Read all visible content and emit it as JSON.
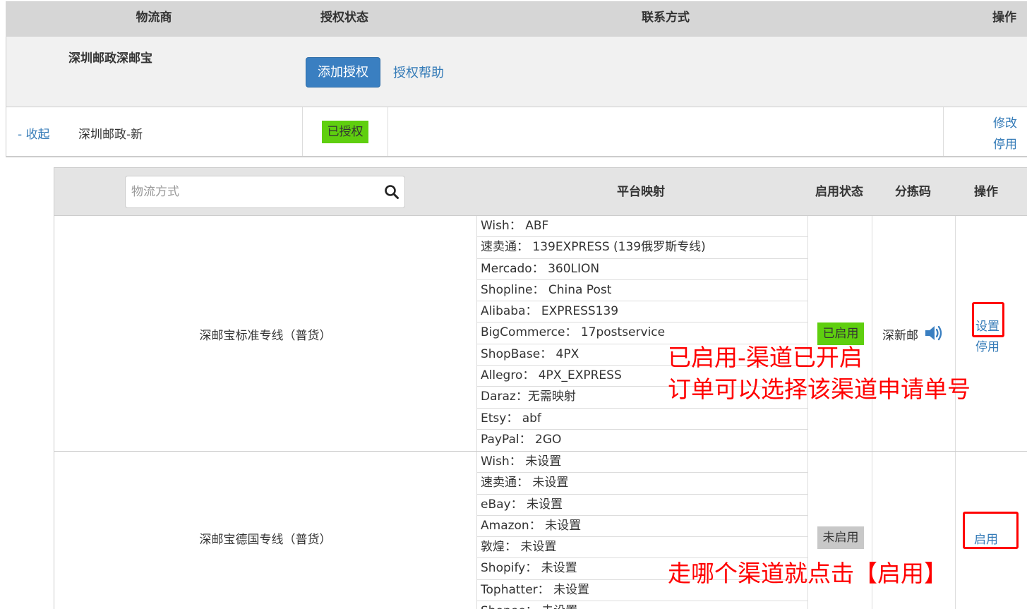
{
  "top_table": {
    "headers": [
      "物流商",
      "授权状态",
      "联系方式",
      "操作"
    ],
    "carrier_name": "深圳邮政深邮宝",
    "add_auth_label": "添加授权",
    "auth_help_label": "授权帮助",
    "account": {
      "collapse_label": "- 收起",
      "name": "深圳邮政-新",
      "status": "已授权",
      "edit_label": "修改",
      "disable_label": "停用"
    }
  },
  "channel_table": {
    "search_placeholder": "物流方式",
    "headers": [
      "平台映射",
      "启用状态",
      "分拣码",
      "操作"
    ],
    "channels": [
      {
        "name": "深邮宝标准专线（普货）",
        "mappings": [
          "Wish： ABF",
          "速卖通： 139EXPRESS (139俄罗斯专线)",
          "Mercado： 360LION",
          "Shopline： China Post",
          "Alibaba： EXPRESS139",
          "BigCommerce： 17postservice",
          "ShopBase： 4PX",
          "Allegro： 4PX_EXPRESS",
          "Daraz：无需映射",
          "Etsy： abf",
          "PayPal： 2GO"
        ],
        "status": "已启用",
        "sort_code": "深新邮",
        "actions": [
          "设置",
          "停用"
        ]
      },
      {
        "name": "深邮宝德国专线（普货）",
        "mappings": [
          "Wish： 未设置",
          "速卖通： 未设置",
          "eBay： 未设置",
          "Amazon： 未设置",
          "敦煌： 未设置",
          "Shopify： 未设置",
          "Tophatter： 未设置",
          "Shopee： 未设置"
        ],
        "status": "未启用",
        "actions": [
          "启用"
        ]
      }
    ]
  },
  "annotations": {
    "enabled_note_line1": "已启用-渠道已开启",
    "enabled_note_line2": "订单可以选择该渠道申请单号",
    "enable_hint": "走哪个渠道就点击【启用】"
  },
  "colors": {
    "header_bg": "#d6d6d6",
    "primary_button": "#3a7fc1",
    "link": "#337ab7",
    "badge_green": "#5fcf0f",
    "badge_gray": "#c8c8c8",
    "annotation_red": "#ff0000"
  }
}
